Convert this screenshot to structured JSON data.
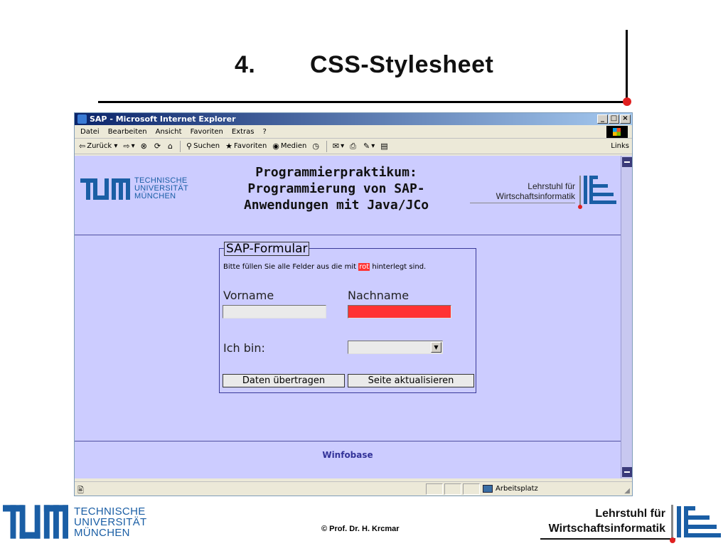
{
  "slide": {
    "title_number": "4.",
    "title_text": "CSS-Stylesheet",
    "footer_copyright": "© Prof. Dr. H. Krcmar",
    "tum_lines": [
      "TECHNISCHE",
      "UNIVERSITÄT",
      "MÜNCHEN"
    ],
    "lehrstuhl_lines": [
      "Lehrstuhl für",
      "Wirtschaftsinformatik"
    ]
  },
  "browser": {
    "title": "SAP - Microsoft Internet Explorer",
    "window_buttons": [
      "_",
      "□",
      "×"
    ],
    "menu": [
      "Datei",
      "Bearbeiten",
      "Ansicht",
      "Favoriten",
      "Extras",
      "?"
    ],
    "toolbar": {
      "back": "Zurück",
      "search": "Suchen",
      "favorites": "Favoriten",
      "media": "Medien",
      "links": "Links"
    },
    "status_zone": "Arbeitsplatz"
  },
  "page": {
    "heading_lines": [
      "Programmierpraktikum:",
      "Programmierung von SAP-",
      "Anwendungen mit Java/JCo"
    ],
    "tum_lines": [
      "TECHNISCHE",
      "UNIVERSITÄT",
      "MÜNCHEN"
    ],
    "lehrstuhl_lines": [
      "Lehrstuhl für",
      "Wirtschaftsinformatik"
    ],
    "form": {
      "legend": "SAP-Formular",
      "hint_before": "Bitte füllen Sie alle Felder aus die mit ",
      "hint_highlight": "rot",
      "hint_after": " hinterlegt sind.",
      "vorname_label": "Vorname",
      "vorname_value": "",
      "nachname_label": "Nachname",
      "nachname_value": "",
      "ichbin_label": "Ich bin:",
      "ichbin_selected": "",
      "submit_label": "Daten übertragen",
      "reset_label": "Seite aktualisieren"
    },
    "footer_link": "Winfobase"
  },
  "colors": {
    "page_bg": "#ccccff",
    "required_field": "#ff3333",
    "tum_blue": "#1a5ea5",
    "accent_red": "#e02020"
  }
}
